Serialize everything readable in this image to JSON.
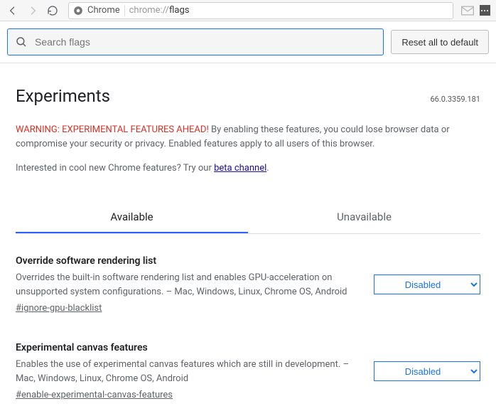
{
  "toolbar": {
    "scheme_label": "Chrome",
    "url_muted": "chrome://",
    "url_rest": "flags"
  },
  "search": {
    "placeholder": "Search flags",
    "value": ""
  },
  "reset_label": "Reset all to default",
  "page": {
    "title": "Experiments",
    "version": "66.0.3359.181",
    "warning_head": "WARNING: EXPERIMENTAL FEATURES AHEAD!",
    "warning_body": " By enabling these features, you could lose browser data or compromise your security or privacy. Enabled features apply to all users of this browser.",
    "beta_prefix": "Interested in cool new Chrome features? Try our ",
    "beta_link": "beta channel",
    "beta_suffix": "."
  },
  "tabs": {
    "available": "Available",
    "unavailable": "Unavailable"
  },
  "flags": [
    {
      "title": "Override software rendering list",
      "desc": "Overrides the built-in software rendering list and enables GPU-acceleration on unsupported system configurations. – Mac, Windows, Linux, Chrome OS, Android",
      "anchor": "#ignore-gpu-blacklist",
      "value": "Disabled"
    },
    {
      "title": "Experimental canvas features",
      "desc": "Enables the use of experimental canvas features which are still in development. – Mac, Windows, Linux, Chrome OS, Android",
      "anchor": "#enable-experimental-canvas-features",
      "value": "Disabled"
    }
  ]
}
